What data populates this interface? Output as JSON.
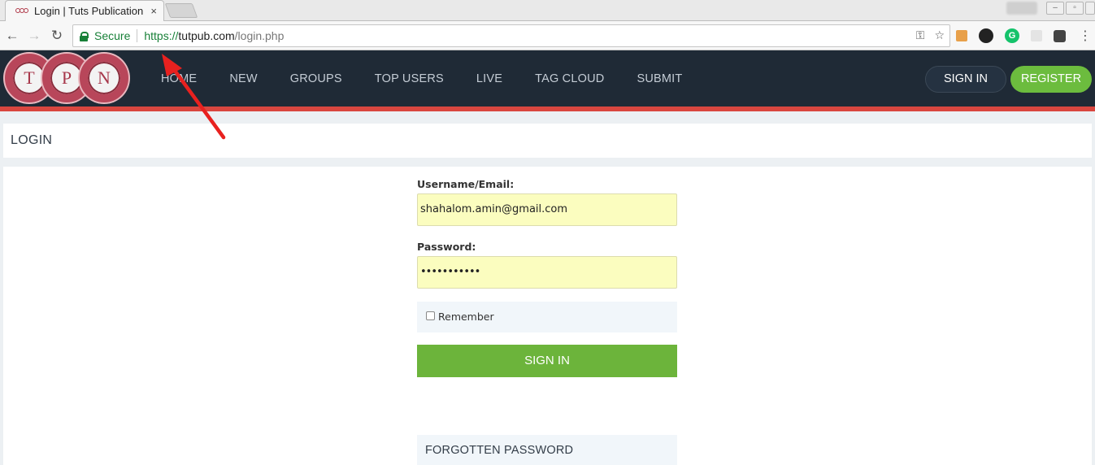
{
  "browser": {
    "tab_title": "Login | Tuts Publication",
    "tab_close": "×",
    "omnibox": {
      "secure_label": "Secure",
      "url_scheme": "https://",
      "url_host": "tutpub.com",
      "url_path": "/login.php"
    }
  },
  "site": {
    "logo_letters": [
      "T",
      "P",
      "N"
    ],
    "nav": [
      "HOME",
      "NEW",
      "GROUPS",
      "TOP USERS",
      "LIVE",
      "TAG CLOUD",
      "SUBMIT"
    ],
    "header_signin_label": "SIGN IN",
    "header_register_label": "REGISTER"
  },
  "page": {
    "heading": "LOGIN",
    "username_label": "Username/Email:",
    "username_value": "shahalom.amin@gmail.com",
    "password_label": "Password:",
    "password_value": "•••••••••••",
    "remember_label": "Remember",
    "signin_button": "SIGN IN",
    "forgotten_password": "FORGOTTEN PASSWORD"
  },
  "colors": {
    "header_bg": "#1f2a36",
    "accent_red": "#d9463f",
    "green": "#6cb43b",
    "autofill_yellow": "#fbfdbf",
    "secure_green": "#188038"
  }
}
